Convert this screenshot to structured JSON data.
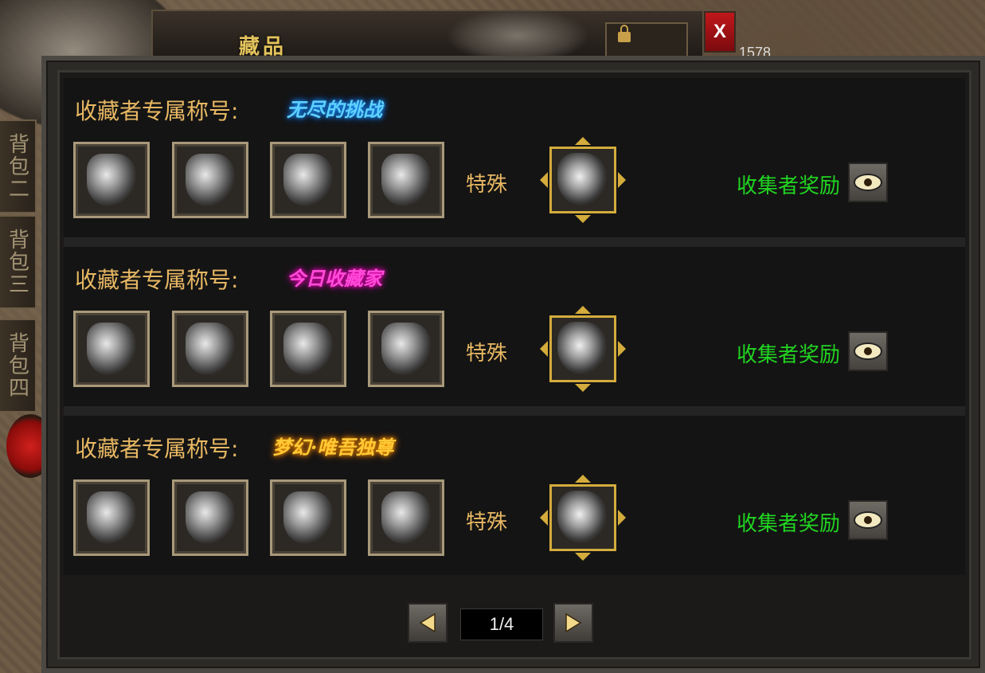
{
  "window": {
    "title": "藏品",
    "close_label": "X",
    "corner_number": "1578",
    "info_label": "!"
  },
  "side_tabs": [
    {
      "label": "背包二"
    },
    {
      "label": "背包三"
    },
    {
      "label": "背包四"
    }
  ],
  "collections": [
    {
      "label": "收藏者专属称号:",
      "title": "无尽的挑战",
      "special_label": "特殊",
      "reward_label": "收集者奖励"
    },
    {
      "label": "收藏者专属称号:",
      "title": "今日收藏家",
      "special_label": "特殊",
      "reward_label": "收集者奖励"
    },
    {
      "label": "收藏者专属称号:",
      "title": "梦幻·唯吾独尊",
      "special_label": "特殊",
      "reward_label": "收集者奖励"
    }
  ],
  "pager": {
    "page_text": "1/4"
  },
  "colors": {
    "label_gold": "#e8b863",
    "reward_green": "#21d421",
    "title_blue": "#5fd0ff",
    "title_pink": "#ff4cd8",
    "title_gold": "#ffc935",
    "close_red": "#c0171b"
  }
}
